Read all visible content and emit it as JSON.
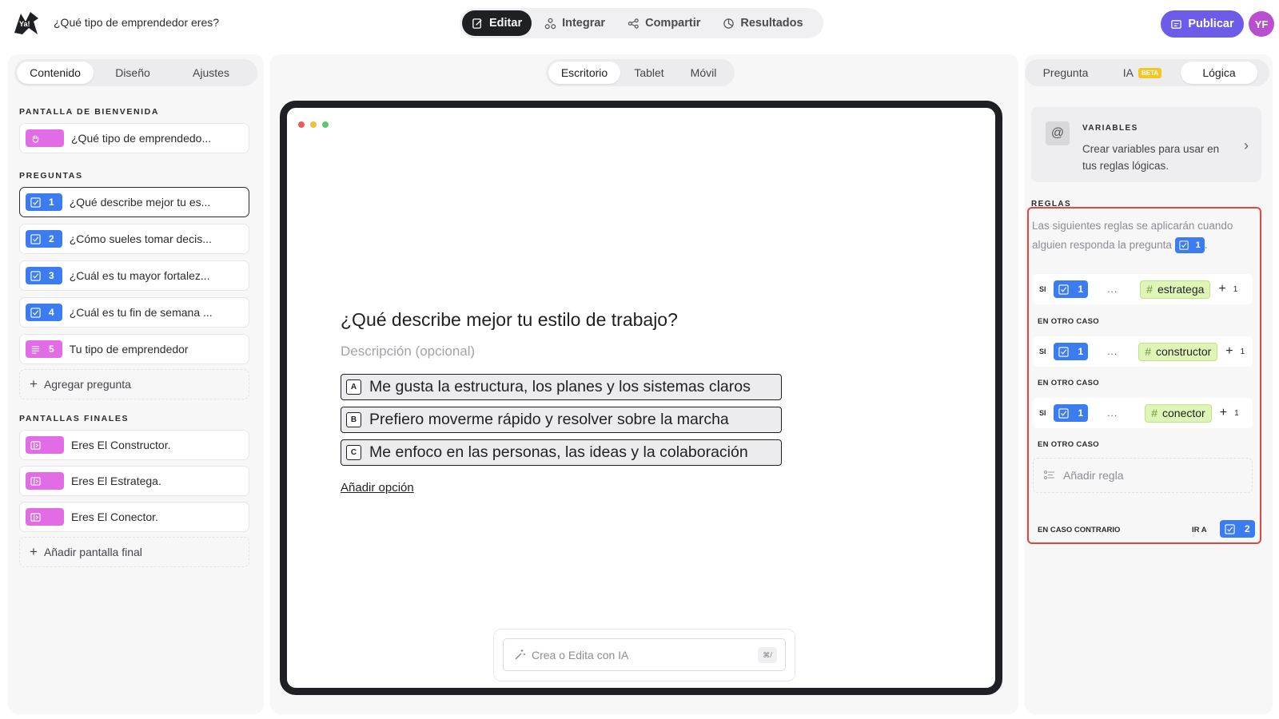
{
  "header": {
    "form_title": "¿Qué tipo de emprendedor eres?",
    "tabs": [
      {
        "label": "Editar",
        "icon": "edit-icon"
      },
      {
        "label": "Integrar",
        "icon": "integrate-icon"
      },
      {
        "label": "Compartir",
        "icon": "share-icon"
      },
      {
        "label": "Resultados",
        "icon": "results-icon"
      }
    ],
    "active_tab": "Editar",
    "publish_label": "Publicar",
    "avatar_initials": "YF"
  },
  "left": {
    "tabs": [
      "Contenido",
      "Diseño",
      "Ajustes"
    ],
    "active_tab": "Contenido",
    "welcome_section": "PANTALLA DE BIENVENIDA",
    "welcome_item": "¿Qué tipo de emprendedo...",
    "questions_section": "PREGUNTAS",
    "questions": [
      {
        "num": "1",
        "text": "¿Qué describe mejor tu es...",
        "icon": "checkbox-icon"
      },
      {
        "num": "2",
        "text": "¿Cómo sueles tomar decis...",
        "icon": "checkbox-icon"
      },
      {
        "num": "3",
        "text": "¿Cuál es tu mayor fortalez...",
        "icon": "checkbox-icon"
      },
      {
        "num": "4",
        "text": "¿Cuál es tu fin de semana ...",
        "icon": "checkbox-icon"
      },
      {
        "num": "5",
        "text": "Tu tipo de emprendedor",
        "icon": "text-lines-icon"
      }
    ],
    "add_question": "Agregar pregunta",
    "endings_section": "PANTALLAS FINALES",
    "endings": [
      "Eres El Constructor.",
      "Eres El Estratega.",
      "Eres El Conector."
    ],
    "add_ending": "Añadir pantalla final"
  },
  "center": {
    "device_tabs": [
      "Escritorio",
      "Tablet",
      "Móvil"
    ],
    "active_device": "Escritorio",
    "question_title": "¿Qué describe mejor tu estilo de trabajo?",
    "description_placeholder": "Descripción (opcional)",
    "choices": [
      {
        "key": "A",
        "text": "Me gusta la estructura, los planes y los sistemas claros"
      },
      {
        "key": "B",
        "text": "Prefiero moverme rápido y resolver sobre la marcha"
      },
      {
        "key": "C",
        "text": "Me enfoco en las personas, las ideas y la colaboración"
      }
    ],
    "add_option": "Añadir opción",
    "ai_placeholder": "Crea o Edita con IA",
    "ai_shortcut": "⌘/"
  },
  "right": {
    "tabs": [
      "Pregunta",
      "IA",
      "Lógica"
    ],
    "ia_badge": "BETA",
    "active_tab": "Lógica",
    "variables_title": "VARIABLES",
    "variables_desc": "Crear variables para usar en tus reglas lógicas.",
    "rules_label": "REGLAS",
    "rules_intro": "Las siguientes reglas se aplicarán cuando alguien responda la pregunta",
    "rules_intro_num": "1",
    "rules": [
      {
        "if_label": "SI",
        "q_num": "1",
        "ellipsis": "...",
        "variable": "estratega",
        "count": "1"
      },
      {
        "if_label": "SI",
        "q_num": "1",
        "ellipsis": "...",
        "variable": "constructor",
        "count": "1"
      },
      {
        "if_label": "SI",
        "q_num": "1",
        "ellipsis": "...",
        "variable": "conector",
        "count": "1"
      }
    ],
    "otherwise_label": "EN OTRO CASO",
    "add_rule": "Añadir regla",
    "else_label": "EN CASO CONTRARIO",
    "goto_label": "IR A",
    "goto_num": "2"
  },
  "colors": {
    "accent": "#6d5ce7",
    "question_badge": "#3b7cf0",
    "screen_badge": "#e26be6",
    "variable_chip": "#dff5b8",
    "highlight_border": "#e0483e"
  }
}
